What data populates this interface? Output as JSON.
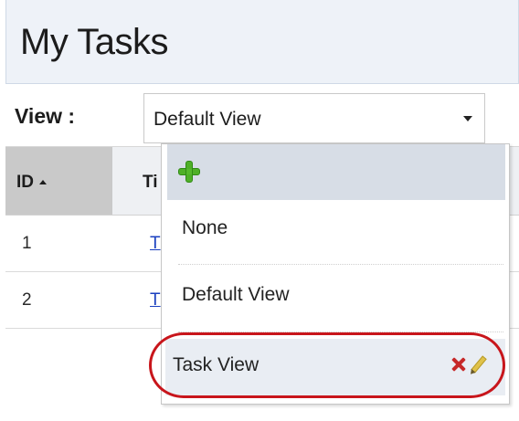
{
  "page": {
    "title": "My Tasks"
  },
  "view_bar": {
    "label": "View :",
    "selected": "Default View"
  },
  "grid": {
    "columns": [
      {
        "label": "ID",
        "sort": "ascending"
      },
      {
        "label": "Ti"
      }
    ],
    "rows": [
      {
        "id": "1",
        "title": "T"
      },
      {
        "id": "2",
        "title": "T"
      }
    ]
  },
  "view_dropdown": {
    "add_icon": "plus-icon",
    "options": [
      {
        "label": "None"
      },
      {
        "label": "Default View"
      },
      {
        "label": "Task View",
        "actions": [
          "delete-icon",
          "edit-icon"
        ]
      }
    ],
    "highlighted_option": "Task View",
    "colors": {
      "add_icon": "#4fb028",
      "delete_icon": "#c62828",
      "edit_icon": "#e0c24a",
      "highlight_ring": "#c8151b"
    }
  }
}
